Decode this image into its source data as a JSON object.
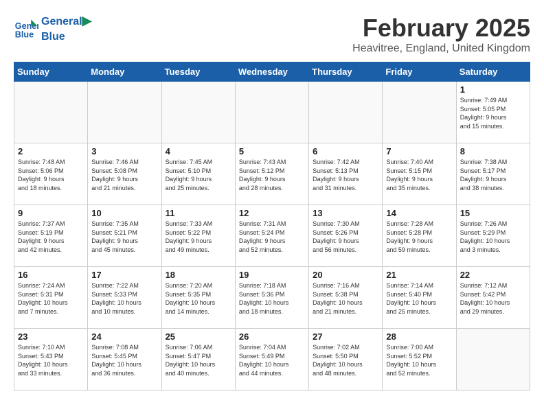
{
  "header": {
    "logo_line1": "General",
    "logo_line2": "Blue",
    "month": "February 2025",
    "location": "Heavitree, England, United Kingdom"
  },
  "weekdays": [
    "Sunday",
    "Monday",
    "Tuesday",
    "Wednesday",
    "Thursday",
    "Friday",
    "Saturday"
  ],
  "weeks": [
    [
      {
        "day": "",
        "info": ""
      },
      {
        "day": "",
        "info": ""
      },
      {
        "day": "",
        "info": ""
      },
      {
        "day": "",
        "info": ""
      },
      {
        "day": "",
        "info": ""
      },
      {
        "day": "",
        "info": ""
      },
      {
        "day": "1",
        "info": "Sunrise: 7:49 AM\nSunset: 5:05 PM\nDaylight: 9 hours\nand 15 minutes."
      }
    ],
    [
      {
        "day": "2",
        "info": "Sunrise: 7:48 AM\nSunset: 5:06 PM\nDaylight: 9 hours\nand 18 minutes."
      },
      {
        "day": "3",
        "info": "Sunrise: 7:46 AM\nSunset: 5:08 PM\nDaylight: 9 hours\nand 21 minutes."
      },
      {
        "day": "4",
        "info": "Sunrise: 7:45 AM\nSunset: 5:10 PM\nDaylight: 9 hours\nand 25 minutes."
      },
      {
        "day": "5",
        "info": "Sunrise: 7:43 AM\nSunset: 5:12 PM\nDaylight: 9 hours\nand 28 minutes."
      },
      {
        "day": "6",
        "info": "Sunrise: 7:42 AM\nSunset: 5:13 PM\nDaylight: 9 hours\nand 31 minutes."
      },
      {
        "day": "7",
        "info": "Sunrise: 7:40 AM\nSunset: 5:15 PM\nDaylight: 9 hours\nand 35 minutes."
      },
      {
        "day": "8",
        "info": "Sunrise: 7:38 AM\nSunset: 5:17 PM\nDaylight: 9 hours\nand 38 minutes."
      }
    ],
    [
      {
        "day": "9",
        "info": "Sunrise: 7:37 AM\nSunset: 5:19 PM\nDaylight: 9 hours\nand 42 minutes."
      },
      {
        "day": "10",
        "info": "Sunrise: 7:35 AM\nSunset: 5:21 PM\nDaylight: 9 hours\nand 45 minutes."
      },
      {
        "day": "11",
        "info": "Sunrise: 7:33 AM\nSunset: 5:22 PM\nDaylight: 9 hours\nand 49 minutes."
      },
      {
        "day": "12",
        "info": "Sunrise: 7:31 AM\nSunset: 5:24 PM\nDaylight: 9 hours\nand 52 minutes."
      },
      {
        "day": "13",
        "info": "Sunrise: 7:30 AM\nSunset: 5:26 PM\nDaylight: 9 hours\nand 56 minutes."
      },
      {
        "day": "14",
        "info": "Sunrise: 7:28 AM\nSunset: 5:28 PM\nDaylight: 9 hours\nand 59 minutes."
      },
      {
        "day": "15",
        "info": "Sunrise: 7:26 AM\nSunset: 5:29 PM\nDaylight: 10 hours\nand 3 minutes."
      }
    ],
    [
      {
        "day": "16",
        "info": "Sunrise: 7:24 AM\nSunset: 5:31 PM\nDaylight: 10 hours\nand 7 minutes."
      },
      {
        "day": "17",
        "info": "Sunrise: 7:22 AM\nSunset: 5:33 PM\nDaylight: 10 hours\nand 10 minutes."
      },
      {
        "day": "18",
        "info": "Sunrise: 7:20 AM\nSunset: 5:35 PM\nDaylight: 10 hours\nand 14 minutes."
      },
      {
        "day": "19",
        "info": "Sunrise: 7:18 AM\nSunset: 5:36 PM\nDaylight: 10 hours\nand 18 minutes."
      },
      {
        "day": "20",
        "info": "Sunrise: 7:16 AM\nSunset: 5:38 PM\nDaylight: 10 hours\nand 21 minutes."
      },
      {
        "day": "21",
        "info": "Sunrise: 7:14 AM\nSunset: 5:40 PM\nDaylight: 10 hours\nand 25 minutes."
      },
      {
        "day": "22",
        "info": "Sunrise: 7:12 AM\nSunset: 5:42 PM\nDaylight: 10 hours\nand 29 minutes."
      }
    ],
    [
      {
        "day": "23",
        "info": "Sunrise: 7:10 AM\nSunset: 5:43 PM\nDaylight: 10 hours\nand 33 minutes."
      },
      {
        "day": "24",
        "info": "Sunrise: 7:08 AM\nSunset: 5:45 PM\nDaylight: 10 hours\nand 36 minutes."
      },
      {
        "day": "25",
        "info": "Sunrise: 7:06 AM\nSunset: 5:47 PM\nDaylight: 10 hours\nand 40 minutes."
      },
      {
        "day": "26",
        "info": "Sunrise: 7:04 AM\nSunset: 5:49 PM\nDaylight: 10 hours\nand 44 minutes."
      },
      {
        "day": "27",
        "info": "Sunrise: 7:02 AM\nSunset: 5:50 PM\nDaylight: 10 hours\nand 48 minutes."
      },
      {
        "day": "28",
        "info": "Sunrise: 7:00 AM\nSunset: 5:52 PM\nDaylight: 10 hours\nand 52 minutes."
      },
      {
        "day": "",
        "info": ""
      }
    ]
  ]
}
